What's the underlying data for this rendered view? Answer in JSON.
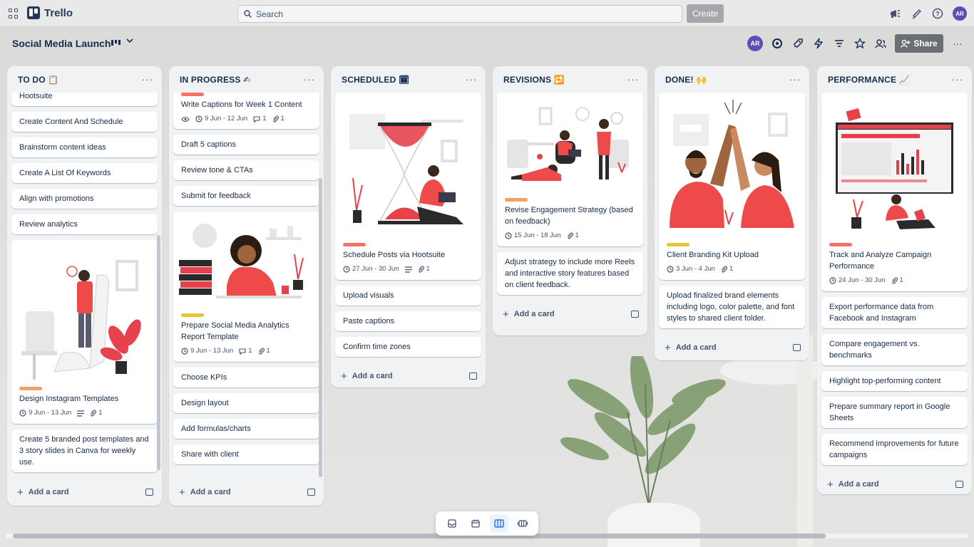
{
  "app": {
    "name": "Trello"
  },
  "search": {
    "placeholder": "Search"
  },
  "topbar": {
    "create_label": "Create",
    "avatar_initials": "AR"
  },
  "board": {
    "title": "Social Media Launch",
    "share_label": "Share",
    "avatar_initials": "AR"
  },
  "lists": [
    {
      "title": "TO DO 📋",
      "cards": [
        {
          "title": "Hootsuite"
        },
        {
          "title": "Create Content And Schedule"
        },
        {
          "title": "Brainstorm content ideas"
        },
        {
          "title": "Create A List Of Keywords"
        },
        {
          "title": "Align with promotions"
        },
        {
          "title": "Review analytics"
        },
        {
          "title": "Design Instagram Templates",
          "label_color": "#f5a06a",
          "dates": "9 Jun - 13 Jun",
          "attachments": "1"
        },
        {
          "title": "Create 5 branded post templates and 3 story slides in Canva for weekly use."
        }
      ],
      "add_label": "Add a card"
    },
    {
      "title": "IN PROGRESS ✍",
      "cards": [
        {
          "title": "Write Captions for Week 1 Content",
          "label_color": "#f87168",
          "dates": "9 Jun - 12 Jun",
          "comments": "1",
          "attachments": "1"
        },
        {
          "title": "Draft 5 captions"
        },
        {
          "title": "Review tone & CTAs"
        },
        {
          "title": "Submit for feedback"
        },
        {
          "title": "Prepare Social Media Analytics Report Template",
          "label_color": "#e2c73d",
          "dates": "9 Jun - 13 Jun",
          "comments": "1",
          "attachments": "1"
        },
        {
          "title": "Choose KPIs"
        },
        {
          "title": "Design layout"
        },
        {
          "title": "Add formulas/charts"
        },
        {
          "title": "Share with client"
        }
      ],
      "add_label": "Add a card"
    },
    {
      "title": "SCHEDULED 🗓",
      "cards": [
        {
          "title": "Schedule Posts via Hootsuite",
          "label_color": "#f87168",
          "dates": "27 Jun - 30 Jun",
          "attachments": "1"
        },
        {
          "title": "Upload visuals"
        },
        {
          "title": "Paste captions"
        },
        {
          "title": "Confirm time zones"
        }
      ],
      "add_label": "Add a card"
    },
    {
      "title": "REVISIONS 🔁",
      "cards": [
        {
          "title": "Revise Engagement Strategy (based on feedback)",
          "label_color": "#f5a06a",
          "dates": "15 Jun - 18 Jun",
          "attachments": "1"
        },
        {
          "title": "Adjust strategy to include more Reels and interactive story features based on client feedback."
        }
      ],
      "add_label": "Add a card"
    },
    {
      "title": "DONE! 🙌",
      "cards": [
        {
          "title": "Client Branding Kit Upload",
          "label_color": "#e2c73d",
          "dates": "3 Jun - 4 Jun",
          "attachments": "1"
        },
        {
          "title": "Upload finalized brand elements including logo, color palette, and font styles to shared client folder."
        }
      ],
      "add_label": "Add a card"
    },
    {
      "title": "PERFORMANCE 📈",
      "cards": [
        {
          "title": "Track and Analyze Campaign Performance",
          "label_color": "#f87168",
          "dates": "24 Jun - 30 Jun",
          "attachments": "1"
        },
        {
          "title": "Export performance data from Facebook and Instagram"
        },
        {
          "title": "Compare engagement vs. benchmarks"
        },
        {
          "title": "Highlight top-performing content"
        },
        {
          "title": "Prepare summary report in Google Sheets"
        },
        {
          "title": "Recommend improvements for future campaigns"
        }
      ],
      "add_label": "Add a card"
    }
  ]
}
